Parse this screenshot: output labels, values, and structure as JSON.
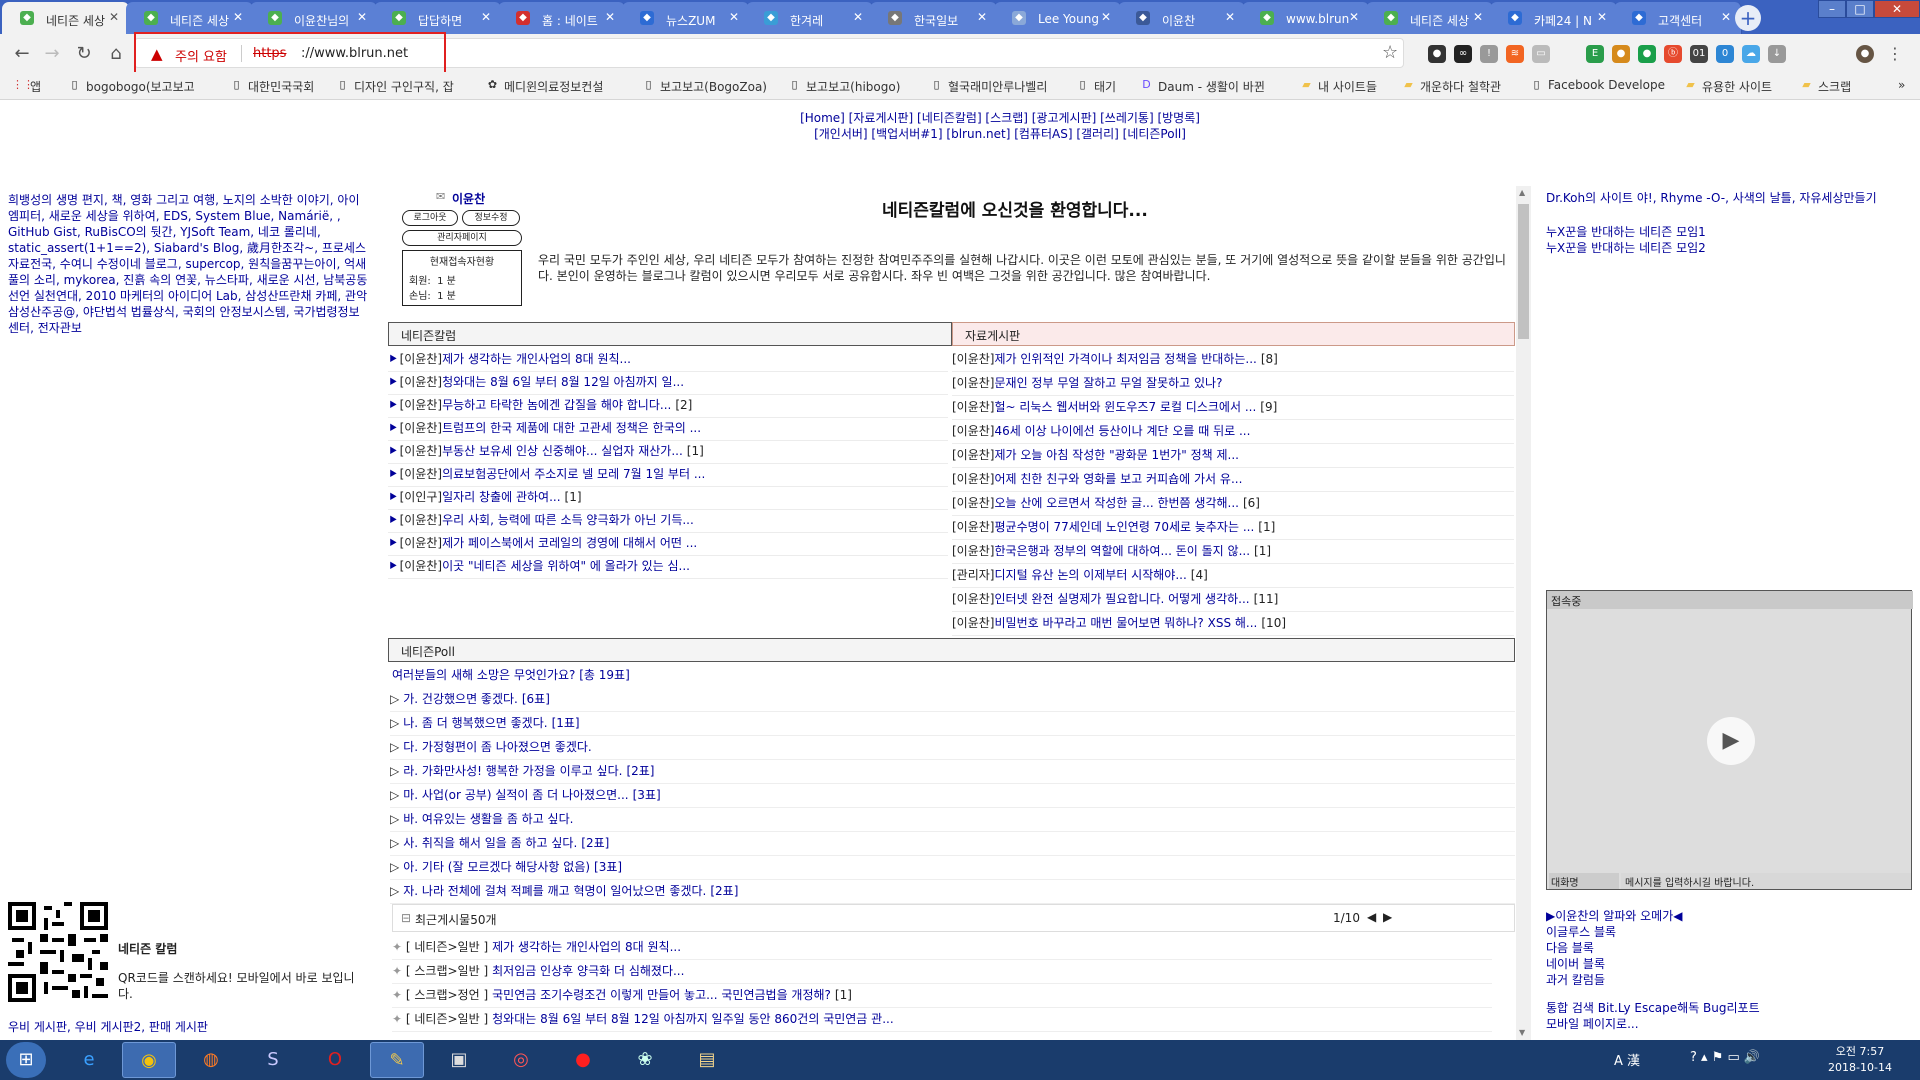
{
  "browser": {
    "tabs": [
      {
        "label": "네티즌 세상",
        "icon": "sprout-icon",
        "color": "#4caf50"
      },
      {
        "label": "네티즌 세상",
        "icon": "sprout-icon",
        "color": "#4caf50"
      },
      {
        "label": "이윤찬님의",
        "icon": "sprout-icon",
        "color": "#4caf50"
      },
      {
        "label": "답답하면 ",
        "icon": "sprout-icon",
        "color": "#4caf50"
      },
      {
        "label": "홈 : 네이트",
        "icon": "nate-icon",
        "color": "#d32f2f"
      },
      {
        "label": "뉴스ZUM",
        "icon": "zum-icon",
        "color": "#2d6bd4"
      },
      {
        "label": "한겨레",
        "icon": "hani-icon",
        "color": "#3a9dd6"
      },
      {
        "label": "한국일보",
        "icon": "hankook-icon",
        "color": "#777777"
      },
      {
        "label": "Lee Young",
        "icon": "profile-icon",
        "color": "#8aa8d8"
      },
      {
        "label": "이윤찬",
        "icon": "facebook-icon",
        "color": "#3b5998"
      },
      {
        "label": "www.blrun",
        "icon": "sprout-icon",
        "color": "#4caf50"
      },
      {
        "label": "네티즌 세상",
        "icon": "sprout-icon",
        "color": "#4caf50"
      },
      {
        "label": "카페24 | N",
        "icon": "cafe24-icon",
        "color": "#2d6bd4"
      },
      {
        "label": "고객센터",
        "icon": "cafe24-icon",
        "color": "#2d6bd4"
      }
    ],
    "active_tab": 0,
    "address": {
      "warning": "주의 요함",
      "scheme": "https",
      "host": "://www.blrun.net"
    },
    "bookmarks": [
      {
        "label": "앱",
        "icon": "apps-icon"
      },
      {
        "label": "bogobogo(보고보고",
        "icon": "page-icon"
      },
      {
        "label": "대한민국국회",
        "icon": "page-icon"
      },
      {
        "label": "디자인 구인구직, 잡",
        "icon": "page-icon"
      },
      {
        "label": "메디윈의료정보컨설",
        "icon": "gear-icon"
      },
      {
        "label": "보고보고(BogoZoa)",
        "icon": "page-icon"
      },
      {
        "label": "보고보고(hibogo)",
        "icon": "page-icon"
      },
      {
        "label": "혈국래미안루나벨리",
        "icon": "page-icon"
      },
      {
        "label": "태기",
        "icon": "page-icon"
      },
      {
        "label": "Daum - 생활이 바뀐",
        "icon": "daum-icon"
      },
      {
        "label": "내 사이트들",
        "icon": "folder-icon"
      },
      {
        "label": "개운하다 철학관",
        "icon": "folder-icon"
      },
      {
        "label": "Facebook Develope",
        "icon": "page-icon"
      },
      {
        "label": "유용한 사이트",
        "icon": "folder-icon"
      },
      {
        "label": "스크랩",
        "icon": "folder-icon"
      }
    ]
  },
  "nav": {
    "row1": "[Home] [자료게시판] [네티즌칼럼] [스크랩] [광고게시판] [쓰레기통] [방명록]",
    "row2": "[개인서버] [백업서버#1] [blrun.net] [컴퓨터AS] [갤러리] [네티즌Poll]"
  },
  "left": {
    "links": "희뱅성의 생명 편지, 책, 영화 그리고 여행, 노지의 소박한 이야기, 아이엠피터, 새로운 세상을 위하여, EDS, System Blue, Namárië, , GitHub Gist, RuBisCO의 뒷간, YJSoft Team, 네코 롤리네, static_assert(1+1==2), Siabard's Blog, 歲月한조각~, 프로세스 자료전국, 수여니 수정이네 블로그, supercop, 원칙을꿈꾸는아이, 억새풀의 소리, mykorea, 진흙 속의 연꽃, 뉴스타파, 새로운 시선, 남북공동선언 실천연대, 2010 마케터의 아이디어 Lab, 삼성산뜨란채 카페, 관악삼성산주공@, 야단법석 법률상식, 국회의 안정보시스템, 국가법령정보센터, 전자관보",
    "qr_title": "네티즌 칼럼",
    "qr_desc": "QR코드를 스캔하세요! 모바일에서 바로 보입니다.",
    "bottom_links": "우비 게시판, 우비 게시판2, 판매 게시판"
  },
  "login": {
    "user": "이윤찬",
    "logout": "로그아웃",
    "edit": "정보수정",
    "admin": "관리자페이지",
    "counter_title": "현재접속자현황",
    "member_label": "회원:",
    "member_count": "1 분",
    "guest_label": "손님:",
    "guest_count": "1 분"
  },
  "main": {
    "welcome": "네티즌칼럼에 오신것을 환영합니다...",
    "intro": "우리 국민 모두가 주인인 세상, 우리 네티즌 모두가 참여하는 진정한 참여민주주의를 실현해 나갑시다. 이곳은 이런 모토에 관심있는 분들, 또 거기에 열성적으로 뜻을 같이할 분들을 위한 공간입니다. 본인이 운영하는 블로그나 칼럼이 있으시면 우리모두 서로 공유합시다. 좌우 빈 여백은 그것을 위한 공간입니다. 많은 참여바랍니다.",
    "column_title": "네티즌칼럼",
    "data_title": "자료게시판",
    "column_posts": [
      {
        "author": "[이윤찬]",
        "title": "제가 생각하는 개인사업의 8대 원칙...",
        "count": ""
      },
      {
        "author": "[이윤찬]",
        "title": "청와대는 8월 6일 부터 8월 12일 아침까지 일...",
        "count": ""
      },
      {
        "author": "[이윤찬]",
        "title": "무능하고 타락한 놈에겐 갑질을 해야 합니다...",
        "count": "[2]"
      },
      {
        "author": "[이윤찬]",
        "title": "트럼프의 한국 제품에 대한 고관세 정책은 한국의 ...",
        "count": ""
      },
      {
        "author": "[이윤찬]",
        "title": "부동산 보유세 인상 신중해야... 실업자 재산가...",
        "count": "[1]"
      },
      {
        "author": "[이윤찬]",
        "title": "의료보험공단에서 주소지로 넬 모레 7월 1일 부터 ...",
        "count": ""
      },
      {
        "author": "[이인구]",
        "title": "일자리 창출에 관하여...",
        "count": "[1]"
      },
      {
        "author": "[이윤찬]",
        "title": "우리 사회, 능력에 따른 소득 양극화가 아닌 기득...",
        "count": ""
      },
      {
        "author": "[이윤찬]",
        "title": "제가 페이스북에서 코레일의 경영에 대해서 어떤 ...",
        "count": ""
      },
      {
        "author": "[이윤찬]",
        "title": "이곳 \"네티즌 세상을 위하여\" 에 올라가 있는 심...",
        "count": ""
      }
    ],
    "data_posts": [
      {
        "author": "[이윤찬]",
        "title": "제가 인위적인 가격이나 최저임금 정책을 반대하는...",
        "count": "[8]"
      },
      {
        "author": "[이윤찬]",
        "title": "문재인 정부 무얼 잘하고 무얼 잘못하고 있나?",
        "count": ""
      },
      {
        "author": "[이윤찬]",
        "title": "헐~ 리눅스 웹서버와 윈도우즈7 로컬 디스크에서 ...",
        "count": "[9]"
      },
      {
        "author": "[이윤찬]",
        "title": "46세 이상 나이에선 등산이나 계단 오를 때 뒤로 ...",
        "count": ""
      },
      {
        "author": "[이윤찬]",
        "title": "제가 오늘 아침 작성한 \"광화문 1번가\" 정책 제...",
        "count": ""
      },
      {
        "author": "[이윤찬]",
        "title": "어제 친한 친구와 영화를 보고 커피숍에 가서 유...",
        "count": ""
      },
      {
        "author": "[이윤찬]",
        "title": "오늘 산에 오르면서 작성한 글... 한번쯤 생각해...",
        "count": "[6]"
      },
      {
        "author": "[이윤찬]",
        "title": "평균수명이 77세인데 노인연령 70세로 늦추자는 ...",
        "count": "[1]"
      },
      {
        "author": "[이윤찬]",
        "title": "한국은행과 정부의 역할에 대하여... 돈이 돌지 않...",
        "count": "[1]"
      },
      {
        "author": "[관리자]",
        "title": "디지털 유산 논의 이제부터 시작해야...",
        "count": "[4]"
      },
      {
        "author": "[이윤찬]",
        "title": "인터넷 완전 실명제가 필요합니다. 어떻게 생각하...",
        "count": "[11]"
      },
      {
        "author": "[이윤찬]",
        "title": "비밀번호 바꾸라고 매번 물어보면 뭐하나? XSS 해...",
        "count": "[10]"
      }
    ],
    "poll_title": "네티즌Poll",
    "poll_question": "여러분들의 새해 소망은 무엇인가요? [총 19표]",
    "poll_options": [
      {
        "text": "가. 건강했으면 좋겠다.",
        "votes": "[6표]"
      },
      {
        "text": "나. 좀 더 행복했으면 좋겠다.",
        "votes": "[1표]"
      },
      {
        "text": "다. 가정형편이 좀 나아졌으면 좋겠다.",
        "votes": ""
      },
      {
        "text": "라. 가화만사성! 행복한 가정을 이루고 싶다.",
        "votes": "[2표]"
      },
      {
        "text": "마. 사업(or 공부) 실적이 좀 더 나아졌으면...",
        "votes": "[3표]"
      },
      {
        "text": "바. 여유있는 생활을 좀 하고 싶다.",
        "votes": ""
      },
      {
        "text": "사. 취직을 해서 일을 좀 하고 싶다.",
        "votes": "[2표]"
      },
      {
        "text": "아. 기타 (잘 모르겠다 해당사항 없음)",
        "votes": "[3표]"
      },
      {
        "text": "자. 나라 전체에 걸쳐 적폐를 깨고 혁명이 일어났으면 좋겠다.",
        "votes": "[2표]"
      }
    ],
    "recent_title": "최근게시물50개",
    "recent_page": "1/10",
    "recent_posts": [
      {
        "category": "[ 네티즌>일반 ]",
        "title": "제가 생각하는 개인사업의 8대 원칙...",
        "count": ""
      },
      {
        "category": "[ 스크랩>일반 ]",
        "title": "최저임금 인상후 양극화 더 심해졌다...",
        "count": ""
      },
      {
        "category": "[ 스크랩>정언 ]",
        "title": "국민연금 조기수령조건 이렇게 만들어 놓고... 국민연금법을 개정해?",
        "count": "[1]"
      },
      {
        "category": "[ 네티즌>일반 ]",
        "title": "청와대는 8월 6일 부터 8월 12일 아침까지 일주일 동안 860건의 국민연금 관...",
        "count": ""
      }
    ]
  },
  "right": {
    "links": "Dr.Koh의 사이트 야!, Rhyme -O-, 사색의 날틀, 자유세상만들기",
    "links_b": [
      "누X꾼을 반대하는 네티즌 모임1",
      "누X꾼을 반대하는 네티즌 모임2"
    ],
    "chat_title": "접속중",
    "chat_name": "대화명",
    "chat_msg": "메시지를 입력하시길 바랍니다.",
    "links2": [
      "▶이윤찬의 알파와 오메가◀",
      "이글루스 블록",
      "다음 블록",
      "네이버 블록",
      "과거 칼럼들"
    ],
    "links3": [
      "통합 검색 Bit.Ly Escape해독 Bug리포트",
      "모바일 페이지로..."
    ]
  },
  "taskbar": {
    "ime": "A 漢",
    "time": "오전 7:57",
    "date": "2018-10-14"
  }
}
